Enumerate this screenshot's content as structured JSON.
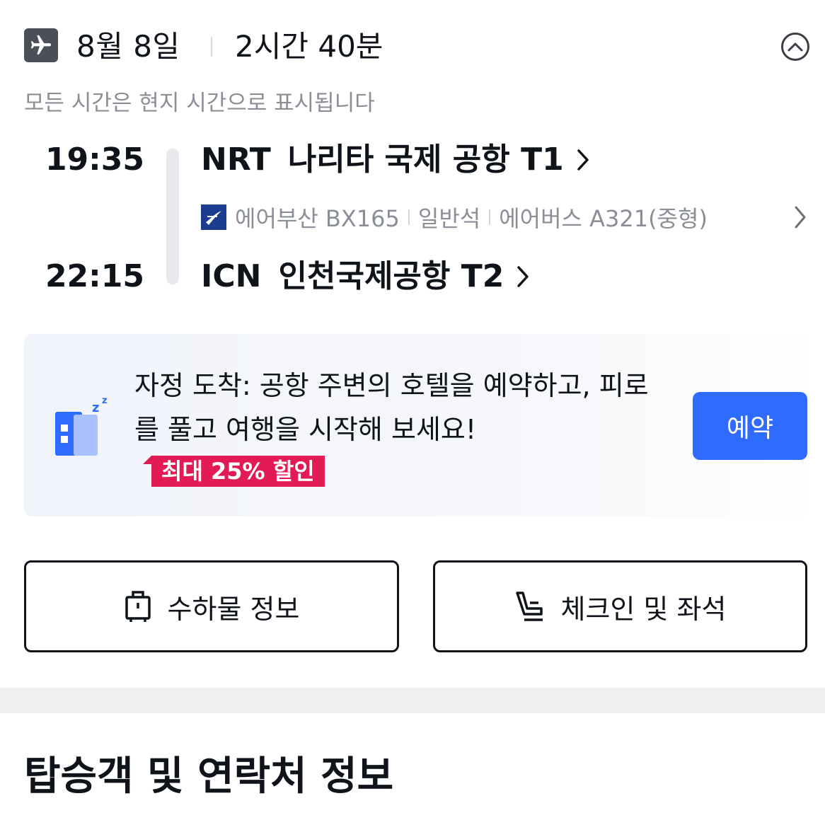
{
  "header": {
    "date": "8월 8일",
    "duration": "2시간 40분"
  },
  "timezone_note": "모든 시간은 현지 시간으로 표시됩니다",
  "departure": {
    "time": "19:35",
    "airport_code": "NRT",
    "airport_name": "나리타 국제 공항 T1"
  },
  "flight": {
    "airline_flight": "에어부산 BX165",
    "cabin": "일반석",
    "aircraft": "에어버스 A321(중형)"
  },
  "arrival": {
    "time": "22:15",
    "airport_code": "ICN",
    "airport_name": "인천국제공항 T2"
  },
  "promo": {
    "text": "자정 도착: 공항 주변의 호텔을 예약하고, 피로를 풀고 여행을 시작해 보세요!",
    "discount_badge": "최대 25% 할인",
    "book_label": "예약"
  },
  "actions": {
    "baggage_label": "수하물 정보",
    "checkin_label": "체크인 및 좌석"
  },
  "section_title": "탑승객 및 연락처 정보",
  "colors": {
    "accent_blue": "#2f6bff",
    "discount_red": "#e31b54",
    "text_primary": "#0f131a",
    "text_secondary": "#8a8e96"
  },
  "icons": {
    "header": "airplane-icon",
    "collapse": "chevron-up-circle-icon",
    "hotel": "hotel-sleep-icon",
    "baggage": "luggage-icon",
    "checkin": "seat-icon"
  }
}
